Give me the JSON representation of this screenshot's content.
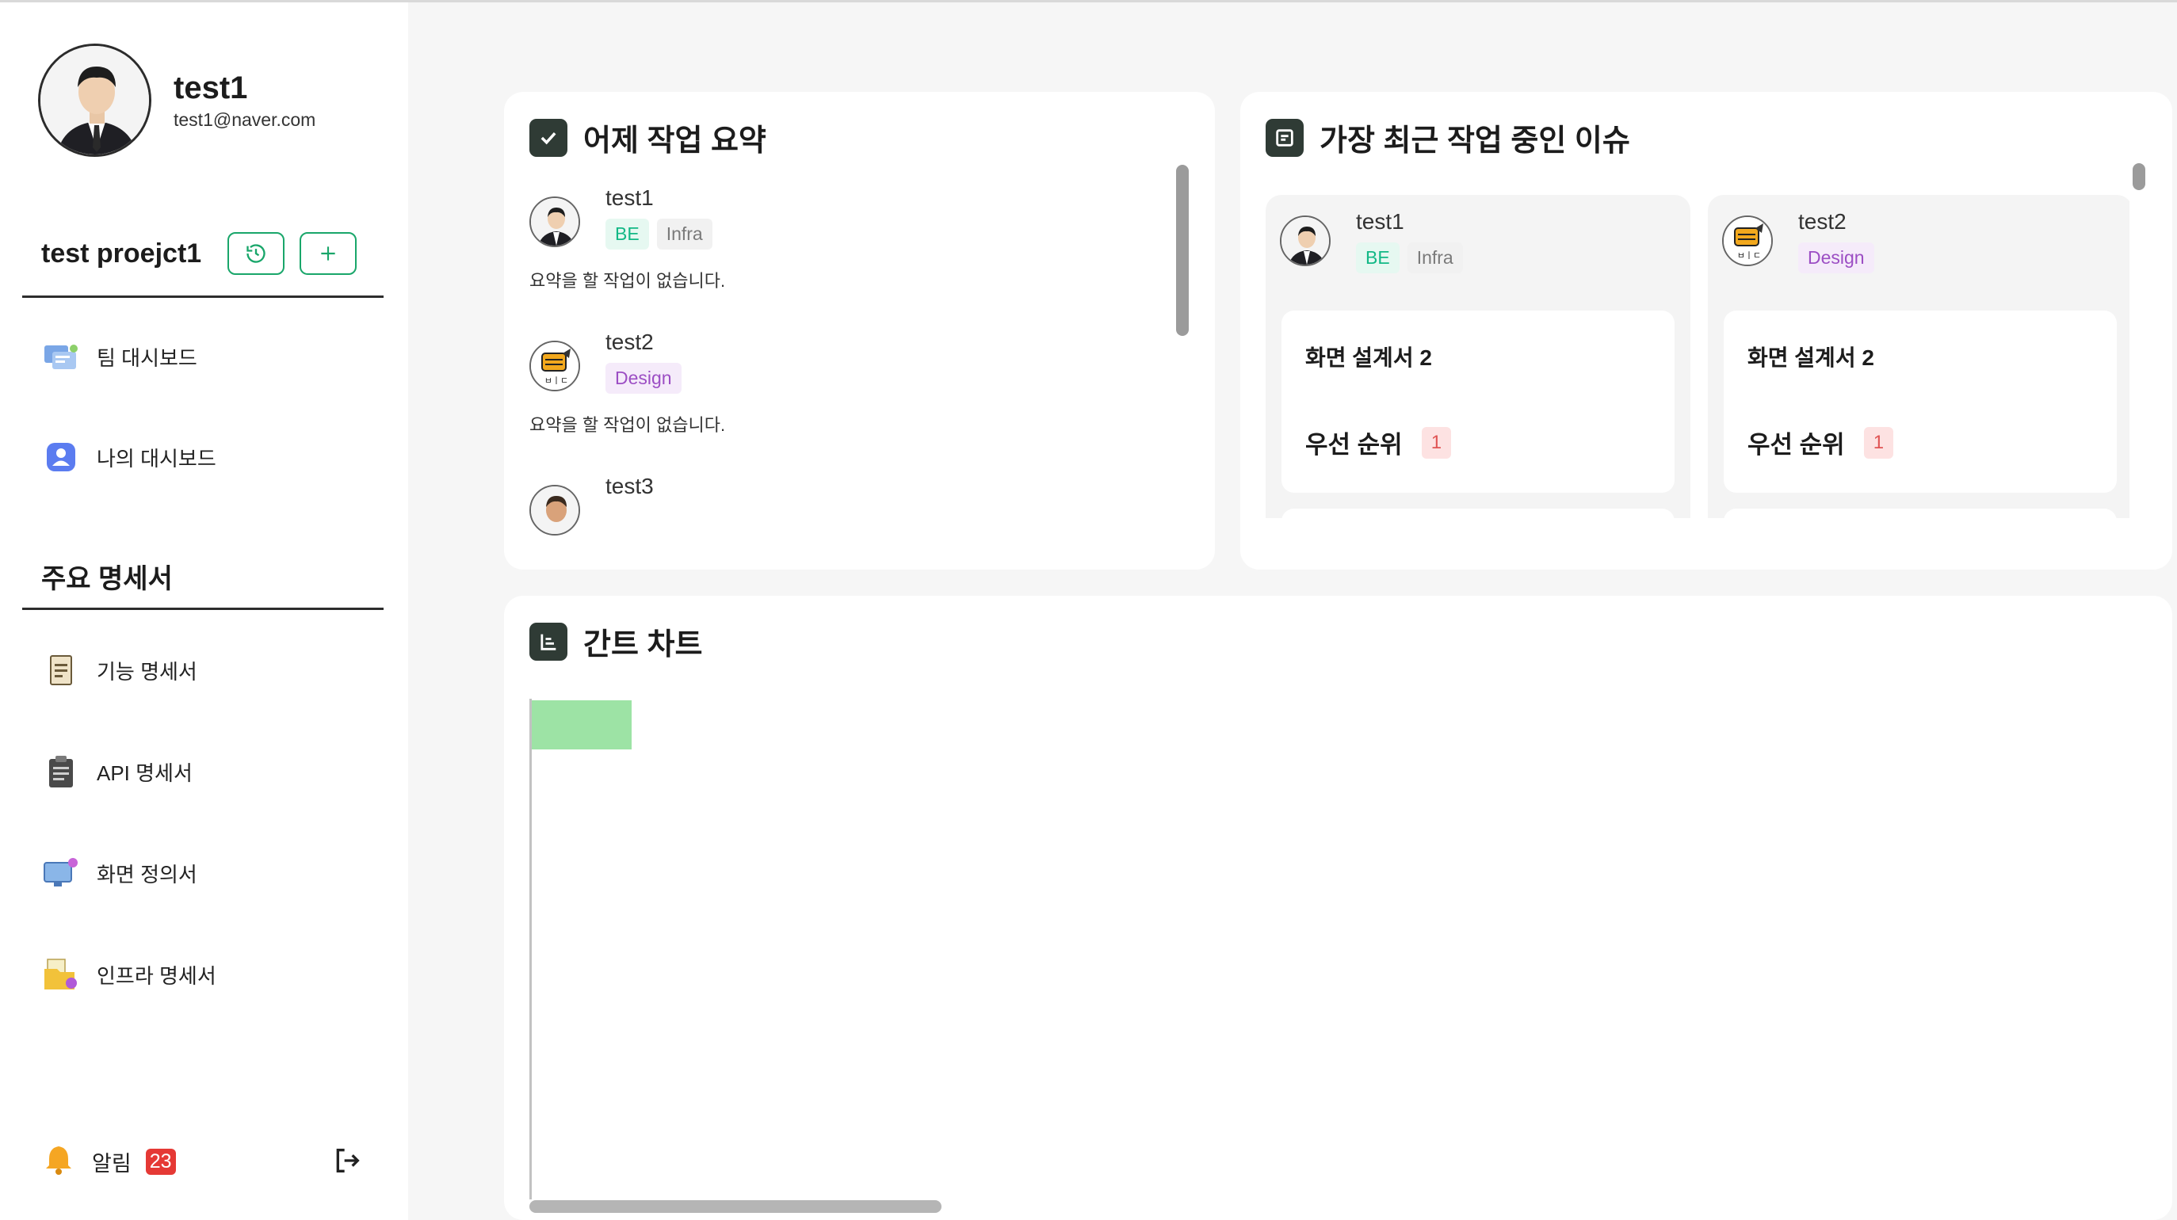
{
  "profile": {
    "name": "test1",
    "email": "test1@naver.com"
  },
  "project": {
    "name": "test proejct1",
    "history_icon": "history-icon",
    "add_icon": "plus-icon"
  },
  "nav": {
    "team_dashboard": "팀 대시보드",
    "my_dashboard": "나의 대시보드"
  },
  "specs": {
    "title": "주요 명세서",
    "items": [
      "기능 명세서",
      "API 명세서",
      "화면 정의서",
      "인프라 명세서"
    ]
  },
  "footer": {
    "alarm_label": "알림",
    "alarm_count": "23",
    "logout_icon": "logout-icon"
  },
  "summary": {
    "title": "어제 작업 요약",
    "items": [
      {
        "name": "test1",
        "tags": [
          "BE",
          "Infra"
        ],
        "note": "요약을 할 작업이 없습니다."
      },
      {
        "name": "test2",
        "tags": [
          "Design"
        ],
        "note": "요약을 할 작업이 없습니다."
      },
      {
        "name": "test3",
        "tags": [],
        "note": ""
      }
    ]
  },
  "issues": {
    "title": "가장 최근 작업 중인 이슈",
    "columns": [
      {
        "name": "test1",
        "tags": [
          "BE",
          "Infra"
        ],
        "card_title": "화면 설계서 2",
        "priority_label": "우선 순위",
        "priority": "1"
      },
      {
        "name": "test2",
        "tags": [
          "Design"
        ],
        "card_title": "화면 설계서 2",
        "priority_label": "우선 순위",
        "priority": "1"
      }
    ]
  },
  "gantt": {
    "title": "간트 차트"
  },
  "colors": {
    "accent": "#19a66a",
    "badge": "#e53935",
    "gantt_bar": "#9de3a5",
    "header_icon": "#2f3b35"
  }
}
